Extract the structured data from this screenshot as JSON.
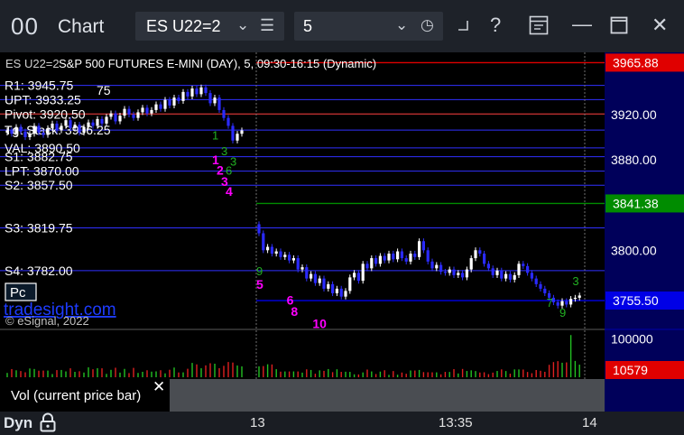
{
  "window": {
    "title": "Chart",
    "logo_glyph": "00",
    "symbol": "ES U22=2",
    "interval": "5"
  },
  "toolbar": {
    "symbol_chevron": "⌄",
    "menu_glyph": "☰",
    "interval_chevron": "⌄",
    "clock_glyph": "◷",
    "help_glyph": "?",
    "minimize_glyph": "—",
    "maximize_glyph": "☐",
    "close_glyph": "✕",
    "help_icon": "help-icon",
    "minimize_icon": "minimize-icon",
    "maximize_icon": "maximize-icon",
    "close_icon": "close-icon"
  },
  "bottom": {
    "mode": "Dyn",
    "lock_icon": "lock-icon",
    "time_labels": [
      "13",
      "13:35",
      "14"
    ]
  },
  "chart_data": {
    "type": "candlestick",
    "title": "ES U22=2 S&P 500 FUTURES E-MINI (DAY), 5, 09:30-16:15 (Dynamic)",
    "title_prefix": "ES U22=2",
    "title_rest": "S&P 500 FUTURES E-MINI (DAY), 5, 09:30-16:15 (Dynamic)",
    "ylim": [
      3730,
      3975
    ],
    "y_ticks": [
      3920.0,
      3880.0,
      3800.0
    ],
    "y_tick_labels": [
      "3920.00",
      "3880.00",
      "3800.00"
    ],
    "x_session_markers": [
      "13",
      "13:35",
      "14"
    ],
    "grid": false,
    "highlighted_prices": [
      {
        "label": "3965.88",
        "value": 3965.88,
        "color": "#e00000"
      },
      {
        "label": "3841.38",
        "value": 3841.38,
        "color": "#008c00"
      },
      {
        "label": "3755.50",
        "value": 3755.5,
        "color": "#0000e6"
      }
    ],
    "levels": [
      {
        "name": "R1",
        "label": "R1: 3945.75",
        "value": 3945.75,
        "color": "#3030ff"
      },
      {
        "name": "UPT",
        "label": "UPT: 3933.25",
        "value": 3933.25,
        "color": "#3030ff"
      },
      {
        "name": "Pivot",
        "label": "Pivot: 3920.50",
        "value": 3920.5,
        "color": "#ff4040"
      },
      {
        "name": "Tgt Stack",
        "label": "Tgt Stack: 3906.25",
        "value": 3906.25,
        "color": "#3030ff"
      },
      {
        "name": "VAL",
        "label": "VAL: 3890.50",
        "value": 3890.5,
        "color": "#3030ff"
      },
      {
        "name": "S1",
        "label": "S1: 3882.75",
        "value": 3882.75,
        "color": "#3030ff"
      },
      {
        "name": "LPT",
        "label": "LPT: 3870.00",
        "value": 3870.0,
        "color": "#3030ff"
      },
      {
        "name": "S2",
        "label": "S2: 3857.50",
        "value": 3857.5,
        "color": "#3030ff"
      },
      {
        "name": "S3",
        "label": "S3: 3819.75",
        "value": 3819.75,
        "color": "#3030ff"
      },
      {
        "name": "S4",
        "label": "S4: 3782.00",
        "value": 3782.0,
        "color": "#3030ff"
      }
    ],
    "extra_label": "75",
    "bars_day1": [
      3906,
      3903,
      3909,
      3905,
      3900,
      3903,
      3910,
      3904,
      3902,
      3908,
      3912,
      3906,
      3910,
      3915,
      3908,
      3911,
      3904,
      3909,
      3913,
      3910,
      3916,
      3912,
      3918,
      3921,
      3914,
      3919,
      3925,
      3920,
      3917,
      3922,
      3926,
      3921,
      3924,
      3929,
      3925,
      3933,
      3928,
      3935,
      3932,
      3940,
      3936,
      3943,
      3938,
      3944,
      3939,
      3930,
      3935,
      3924,
      3917,
      3910,
      3897,
      3903,
      3906
    ],
    "bars_day2": [
      3815,
      3800,
      3803,
      3797,
      3799,
      3794,
      3796,
      3791,
      3793,
      3783,
      3785,
      3775,
      3779,
      3771,
      3775,
      3766,
      3770,
      3762,
      3766,
      3759,
      3764,
      3776,
      3780,
      3773,
      3788,
      3784,
      3793,
      3788,
      3795,
      3791,
      3797,
      3792,
      3799,
      3793,
      3790,
      3797,
      3794,
      3808,
      3800,
      3790,
      3784,
      3787,
      3781,
      3780,
      3783,
      3778,
      3780,
      3776,
      3783,
      3793,
      3800,
      3797,
      3788,
      3784,
      3778,
      3782,
      3775,
      3779,
      3774,
      3778,
      3788,
      3786,
      3780,
      3775,
      3770,
      3766,
      3762,
      3758,
      3754,
      3751,
      3755,
      3752,
      3757,
      3758,
      3760
    ],
    "volume": {
      "ylim": [
        0,
        120000
      ],
      "tick_label": "100000",
      "tick_value": 100000,
      "current_label": "10579",
      "current_value": 10579,
      "indicator_label": "Vol (current price bar)"
    },
    "countdown_magenta": [
      {
        "label": "1",
        "day": 1,
        "bar": 46,
        "value": 3876
      },
      {
        "label": "2",
        "day": 1,
        "bar": 47,
        "value": 3867
      },
      {
        "label": "3",
        "day": 1,
        "bar": 48,
        "value": 3857
      },
      {
        "label": "4",
        "day": 1,
        "bar": 49,
        "value": 3848
      },
      {
        "label": "5",
        "day": 2,
        "bar": 0,
        "value": 3766
      },
      {
        "label": "6",
        "day": 2,
        "bar": 7,
        "value": 3752
      },
      {
        "label": "8",
        "day": 2,
        "bar": 8,
        "value": 3742
      },
      {
        "label": "10",
        "day": 2,
        "bar": 13,
        "value": 3731
      }
    ],
    "countdown_green": [
      {
        "label": "1",
        "day": 1,
        "bar": 46,
        "value": 3898
      },
      {
        "label": "3",
        "day": 1,
        "bar": 48,
        "value": 3884
      },
      {
        "label": "6",
        "day": 1,
        "bar": 49,
        "value": 3867
      },
      {
        "label": "3",
        "day": 1,
        "bar": 50,
        "value": 3875
      },
      {
        "label": "9",
        "day": 2,
        "bar": 0,
        "value": 3778
      },
      {
        "label": "7",
        "day": 2,
        "bar": 67,
        "value": 3750
      },
      {
        "label": "9",
        "day": 2,
        "bar": 70,
        "value": 3741
      },
      {
        "label": "3",
        "day": 2,
        "bar": 73,
        "value": 3769
      }
    ],
    "branding": {
      "watermark": "tradesight.com",
      "copyright": "© eSignal, 2022",
      "pc_button": "Pc"
    }
  }
}
